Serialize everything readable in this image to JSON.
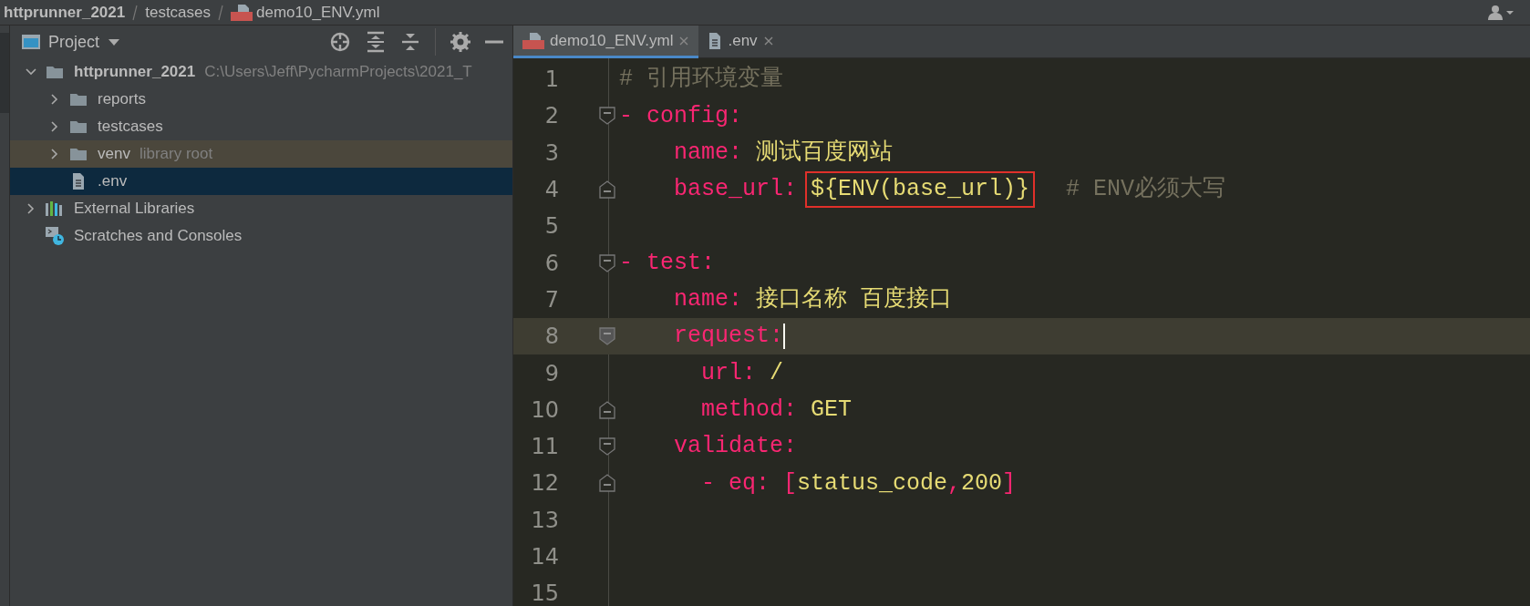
{
  "breadcrumb": [
    {
      "label": "httprunner_2021",
      "kind": "project"
    },
    {
      "label": "testcases",
      "kind": "folder"
    },
    {
      "label": "demo10_ENV.yml",
      "kind": "yml"
    }
  ],
  "project_panel": {
    "title": "Project",
    "tree": [
      {
        "label": "httprunner_2021",
        "hint": "C:\\Users\\Jeff\\PycharmProjects\\2021_T",
        "kind": "project",
        "expanded": true,
        "selected": false,
        "highlighted": false,
        "children": [
          {
            "label": "reports",
            "kind": "folder",
            "expanded": false,
            "selected": false,
            "highlighted": false
          },
          {
            "label": "testcases",
            "kind": "folder",
            "expanded": false,
            "selected": false,
            "highlighted": false
          },
          {
            "label": "venv",
            "hint": "library root",
            "kind": "folder",
            "expanded": false,
            "selected": false,
            "highlighted": true
          },
          {
            "label": ".env",
            "kind": "file",
            "selected": true,
            "highlighted": false
          }
        ]
      },
      {
        "label": "External Libraries",
        "kind": "libraries",
        "expanded": false,
        "selected": false,
        "highlighted": false
      },
      {
        "label": "Scratches and Consoles",
        "kind": "scratches",
        "selected": false,
        "highlighted": false
      }
    ]
  },
  "tabs": [
    {
      "label": "demo10_ENV.yml",
      "kind": "yml",
      "selected": true
    },
    {
      "label": ".env",
      "kind": "file",
      "selected": false
    }
  ],
  "editor": {
    "lines": [
      {
        "number": "1",
        "current": false,
        "tokens": [
          {
            "kind": "comment",
            "text": "# 引用环境变量"
          }
        ]
      },
      {
        "number": "2",
        "current": false,
        "kind": "fold-start",
        "tokens": [
          {
            "kind": "key",
            "text": "- config:"
          }
        ]
      },
      {
        "number": "3",
        "current": false,
        "tokens": [
          {
            "kind": "key",
            "text": "    name: "
          },
          {
            "kind": "value",
            "text": "测试百度网站"
          }
        ]
      },
      {
        "number": "4",
        "current": false,
        "kind": "fold-end",
        "tokens": [
          {
            "kind": "key",
            "text": "    base_url: "
          },
          {
            "kind": "value",
            "text": "${ENV(base_url)}",
            "boxed": true
          },
          {
            "kind": "comment",
            "text": "  # ENV必须大写"
          }
        ]
      },
      {
        "number": "5",
        "current": false
      },
      {
        "number": "6",
        "current": false,
        "kind": "fold-start",
        "tokens": [
          {
            "kind": "key",
            "text": "- test:"
          }
        ]
      },
      {
        "number": "7",
        "current": false,
        "tokens": [
          {
            "kind": "key",
            "text": "    name: "
          },
          {
            "kind": "value",
            "text": "接口名称 百度接口"
          }
        ]
      },
      {
        "number": "8",
        "current": true,
        "kind": "fold-start",
        "tokens": [
          {
            "kind": "key",
            "text": "    request:"
          }
        ]
      },
      {
        "number": "9",
        "current": false,
        "tokens": [
          {
            "kind": "key",
            "text": "      url: "
          },
          {
            "kind": "value",
            "text": "/"
          }
        ]
      },
      {
        "number": "10",
        "current": false,
        "kind": "fold-end",
        "tokens": [
          {
            "kind": "key",
            "text": "      method: "
          },
          {
            "kind": "value",
            "text": "GET"
          }
        ]
      },
      {
        "number": "11",
        "current": false,
        "kind": "fold-start",
        "tokens": [
          {
            "kind": "key",
            "text": "    validate:"
          }
        ]
      },
      {
        "number": "12",
        "current": false,
        "kind": "fold-end",
        "tokens": [
          {
            "kind": "key",
            "text": "      - eq: ["
          },
          {
            "kind": "value",
            "text": "status_code"
          },
          {
            "kind": "key",
            "text": ","
          },
          {
            "kind": "value",
            "text": "200"
          },
          {
            "kind": "key",
            "text": "]"
          }
        ]
      },
      {
        "number": "13",
        "current": false
      },
      {
        "number": "14",
        "current": false
      },
      {
        "number": "15",
        "current": false
      }
    ]
  }
}
